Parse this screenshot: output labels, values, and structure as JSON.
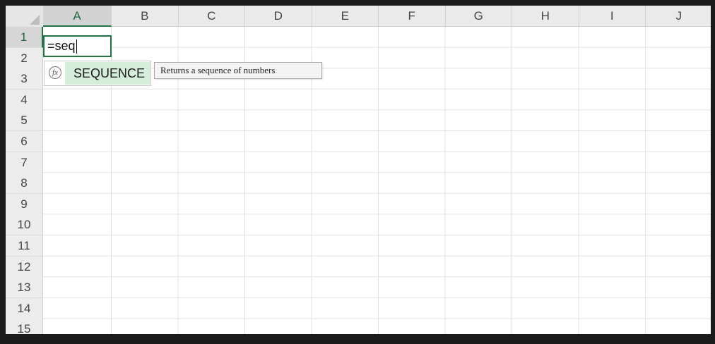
{
  "columns": [
    "A",
    "B",
    "C",
    "D",
    "E",
    "F",
    "G",
    "H",
    "I",
    "J"
  ],
  "rows": [
    "1",
    "2",
    "3",
    "4",
    "5",
    "6",
    "7",
    "8",
    "9",
    "10",
    "11",
    "12",
    "13",
    "14",
    "15"
  ],
  "active_cell": {
    "column": "A",
    "row": "1",
    "value": "=seq"
  },
  "autocomplete": {
    "icon": "fx-function-icon",
    "icon_glyph": "fx",
    "item_label": "SEQUENCE"
  },
  "tooltip": {
    "text": "Returns a sequence of numbers"
  },
  "colors": {
    "accent": "#217346",
    "highlight": "#d4eedb",
    "header_bg": "#eaeaea",
    "gridline": "#e1e1e1"
  }
}
